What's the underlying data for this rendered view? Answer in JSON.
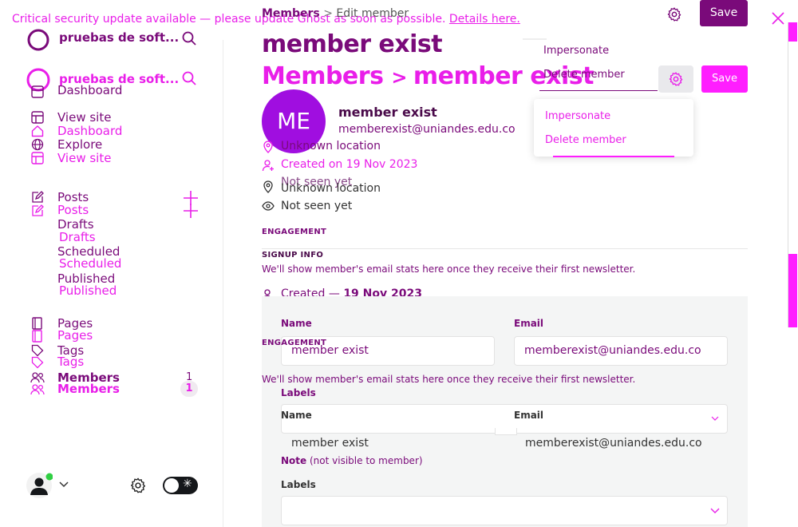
{
  "banner": {
    "text": "Critical security update available — please update Ghost as soon as possible.",
    "link": "Details here."
  },
  "top_crumb": {
    "parent": "Members",
    "current": "Edit member"
  },
  "site_name": "pruebas de soft...",
  "nav": {
    "dashboard": "Dashboard",
    "view_site": "View site",
    "explore": "Explore",
    "posts": "Posts",
    "drafts": "Drafts",
    "scheduled": "Scheduled",
    "published": "Published",
    "pages": "Pages",
    "tags": "Tags",
    "members": "Members",
    "members_count": "1"
  },
  "header": {
    "title": "member exist",
    "breadcrumb_parent": "Members",
    "breadcrumb_current": "member exist",
    "save_label": "Save",
    "menu": [
      "Impersonate",
      "Delete member"
    ]
  },
  "member": {
    "initials": "ME",
    "name": "member exist",
    "email": "memberexist@uniandes.edu.co",
    "location": "Unknown location",
    "created": "Created on 19 Nov 2023",
    "seen": "Not seen yet",
    "created_prefix": "Created —",
    "created_date": "19 Nov 2023"
  },
  "sections": {
    "engagement": "ENGAGEMENT",
    "signup_info": "SIGNUP INFO",
    "stats_note": "We'll show member's email stats here once they receive their first newsletter."
  },
  "form": {
    "name_label": "Name",
    "email_label": "Email",
    "labels_label": "Labels",
    "note_label": "Note",
    "note_hint": "(not visible to member)"
  },
  "colors": {
    "accent": "#e91ee9",
    "dark_accent": "#7a0a7a",
    "online": "#30cf43"
  }
}
